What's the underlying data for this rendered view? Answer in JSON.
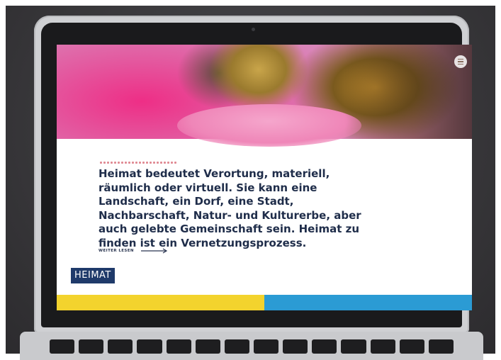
{
  "content": {
    "intro_text": "Heimat bedeutet Verortung, materiell, räumlich oder virtuell. Sie kann eine Landschaft, ein Dorf, eine Stadt, Nachbarschaft, Natur- und Kulturerbe, aber auch gelebte Gemeinschaft sein. Heimat zu finden ist ein Vernetzungsprozess.",
    "read_more_label": "WEITER LESEN",
    "read_more_icon": "arrow-right-icon"
  },
  "branding": {
    "badge_label": "HEIMAT"
  },
  "header": {
    "menu_icon": "menu-icon"
  },
  "colors": {
    "text": "#1f2d4a",
    "badge": "#1f3a6a",
    "accent_dots": "#e08a93",
    "bar_yellow": "#f3d32d",
    "bar_blue": "#2b9bd4",
    "hero_pink": "#ee2e86"
  }
}
